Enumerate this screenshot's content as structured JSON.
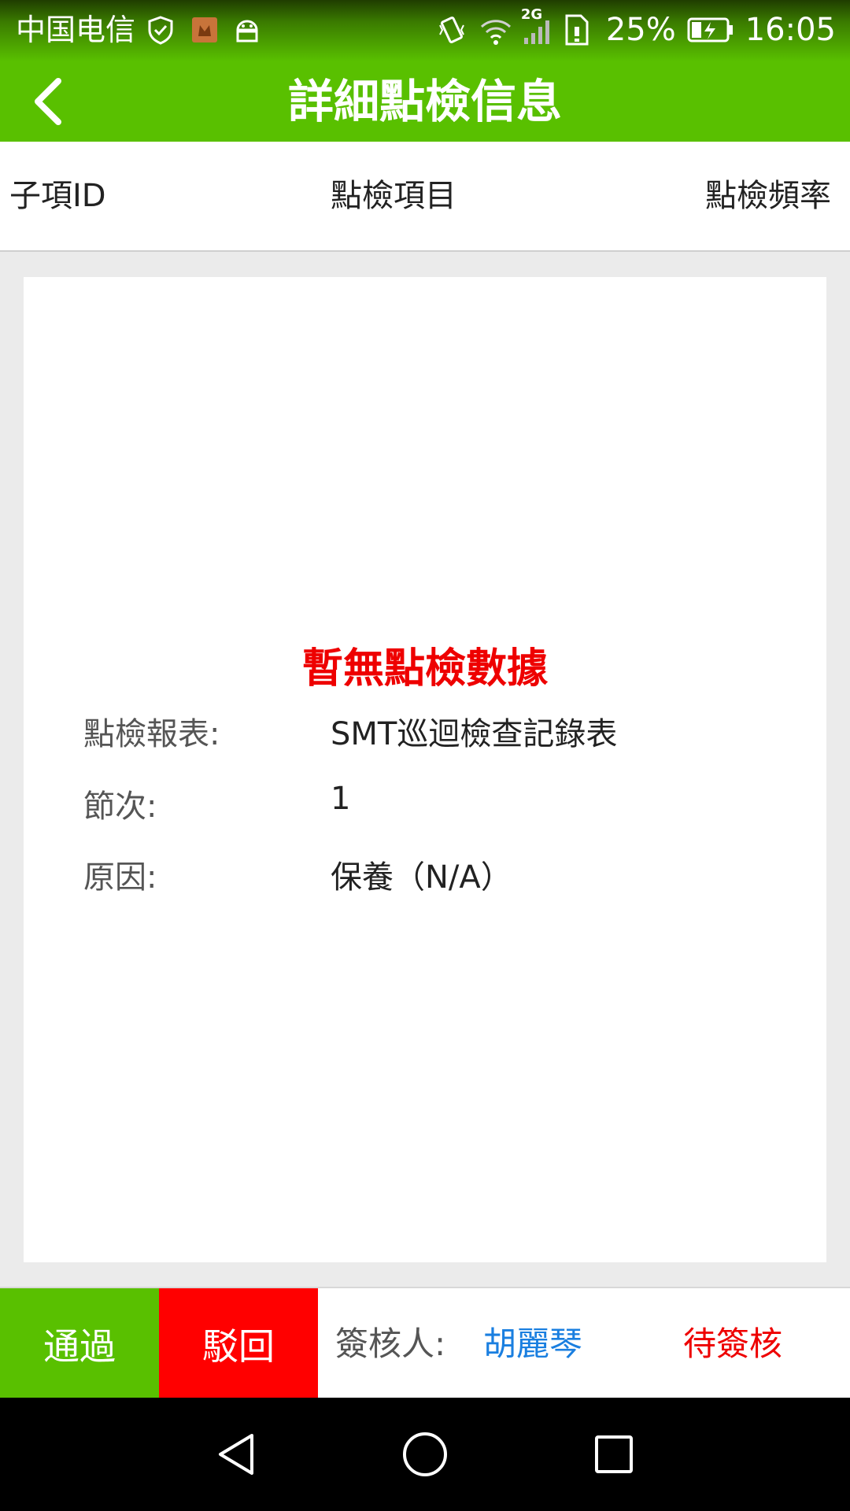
{
  "status_bar": {
    "carrier": "中国电信",
    "network_type": "2G",
    "battery": "25%",
    "time": "16:05",
    "icons": [
      "shield-check-icon",
      "app-notification-icon",
      "android-icon",
      "vibrate-icon",
      "wifi-icon",
      "signal-icon",
      "sim-icon",
      "battery-charging-icon"
    ]
  },
  "header": {
    "title": "詳細點檢信息",
    "back_icon": "chevron-left-icon"
  },
  "columns": [
    "子項ID",
    "點檢項目",
    "點檢頻率"
  ],
  "card": {
    "empty_message": "暫無點檢數據",
    "rows": [
      {
        "label": "點檢報表:",
        "value": "SMT巡迴檢查記錄表"
      },
      {
        "label": "節次:",
        "value": "1"
      },
      {
        "label": "原因:",
        "value": "保養（N/A）"
      }
    ]
  },
  "actions": {
    "pass_label": "通過",
    "reject_label": "駁回",
    "approver_label": "簽核人:",
    "approver_name": "胡麗琴",
    "status": "待簽核"
  },
  "colors": {
    "primary_green": "#59c000",
    "reject_red": "#ff0000",
    "link_blue": "#1a7fe0",
    "alert_red": "#ee0000"
  }
}
